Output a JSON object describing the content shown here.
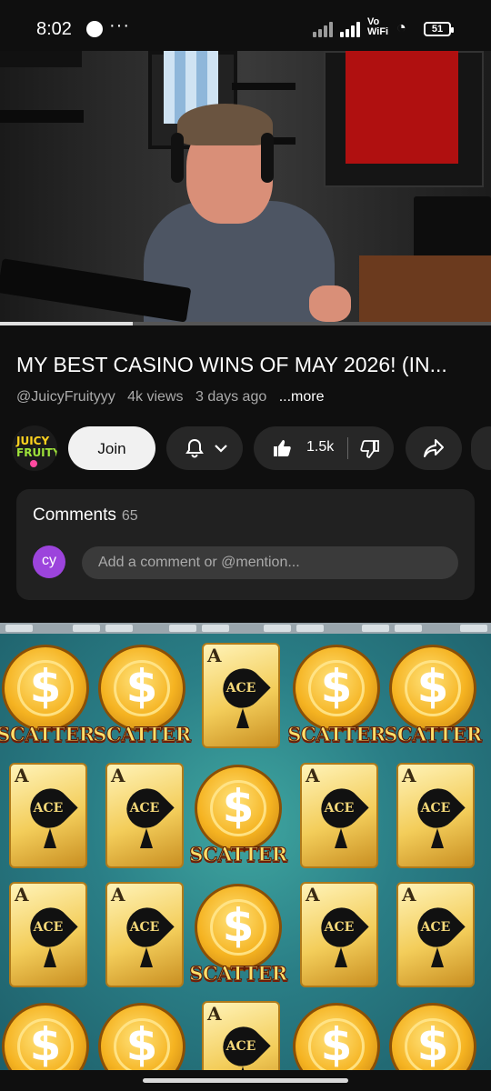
{
  "status_bar": {
    "time": "8:02",
    "dots": "···",
    "vowifi": "Vo\nWiFi",
    "battery": "51"
  },
  "video": {
    "progress": 0.27
  },
  "info": {
    "title": "MY BEST CASINO WINS OF MAY 2026! (IN...",
    "channel_handle": "@JuicyFruityyy",
    "views": "4k views",
    "age": "3 days ago",
    "more": "...more"
  },
  "actions": {
    "avatar_text_1": "JUICY",
    "avatar_text_2": "FRUITY",
    "join": "Join",
    "likes": "1.5k"
  },
  "comments": {
    "label": "Comments",
    "count": "65",
    "user_initials": "cy",
    "placeholder": "Add a comment or @mention..."
  },
  "game": {
    "symbol_ace": "ACE",
    "symbol_ace_corner": "A",
    "symbol_coin": "$",
    "symbol_scatter": "SCATTER",
    "rows": [
      [
        "scatter",
        "scatter",
        "ace",
        "scatter",
        "scatter"
      ],
      [
        "ace",
        "ace",
        "scatter",
        "ace",
        "ace"
      ],
      [
        "ace",
        "ace",
        "scatter",
        "ace",
        "ace"
      ],
      [
        "scatter",
        "scatter",
        "ace",
        "scatter",
        "scatter"
      ]
    ]
  },
  "colors": {
    "background": "#0f0f0f",
    "card": "#212121",
    "pill": "#272727",
    "avatar_comment": "#9c44dc"
  }
}
